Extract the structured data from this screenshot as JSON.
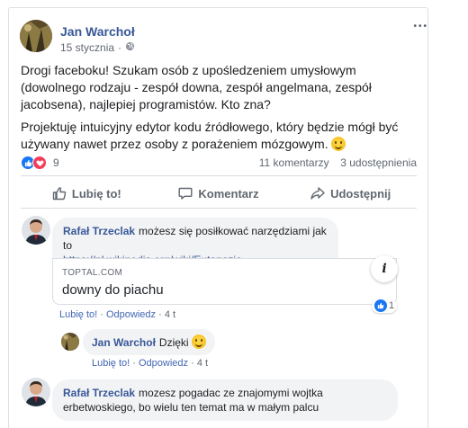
{
  "post": {
    "author": "Jan Warchoł",
    "date": "15 stycznia",
    "date_separator": "·",
    "more_label": "•••",
    "paragraphs": [
      "Drogi faceboku! Szukam osób z upośledzeniem umysłowym (dowolnego rodzaju - zespół downa, zespół angelmana, zespół jacobsena), najlepiej programistów. Kto zna?",
      "Projektuję intuicyjny edytor kodu źródłowego, który będzie mógł być używany nawet przez osoby z porażeniem mózgowym."
    ],
    "reaction_count": "9",
    "comments_count": "11 komentarzy",
    "shares_count": "3 udostępnienia"
  },
  "actions": {
    "like": "Lubię to!",
    "comment": "Komentarz",
    "share": "Udostępnij"
  },
  "comments": [
    {
      "author": "Rafał Trzeclak",
      "text": "możesz się posiłkować narzędziami jak to",
      "link": "https://pl.wikipedia.org/wiki/Eutanazja",
      "preview_domain": "TOPTAL.COM",
      "preview_title": "downy do piachu",
      "preview_info": "i",
      "like_count": "1",
      "like_label": "Lubię to!",
      "reply_label": "Odpowiedz",
      "sep": "·",
      "time": "4 t"
    },
    {
      "author": "Jan Warchoł",
      "text": "Dzięki",
      "like_label": "Lubię to!",
      "reply_label": "Odpowiedz",
      "sep": "·",
      "time": "4 t"
    },
    {
      "author": "Rafał Trzeclak",
      "text": "mozesz pogadac ze znajomymi wojtka erbetwoskiego, bo wielu ten temat ma w małym palcu"
    }
  ],
  "colors": {
    "link_blue": "#385898",
    "like_blue": "#1877f2",
    "love_red": "#f33e58",
    "bubble_gray": "#f2f3f5"
  }
}
